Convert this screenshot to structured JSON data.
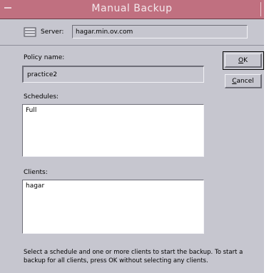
{
  "window": {
    "title": "Manual Backup"
  },
  "server": {
    "label": "Server:",
    "value": "hagar.min.ov.com"
  },
  "policy": {
    "label": "Policy name:",
    "value": "practice2"
  },
  "schedules": {
    "label": "Schedules:",
    "items": [
      "Full"
    ]
  },
  "clients": {
    "label": "Clients:",
    "items": [
      "hagar"
    ]
  },
  "buttons": {
    "ok_label": "OK",
    "ok_underline": "O",
    "ok_rest": "K",
    "cancel_label": "Cancel",
    "cancel_underline": "C",
    "cancel_rest": "ancel"
  },
  "hint": "Select a schedule and one or more clients to start the backup. To start a backup for all clients, press OK without selecting any clients.",
  "icons": {
    "window_menu": "window-menu-icon",
    "server": "server-icon"
  },
  "colors": {
    "titlebar": "#c07080",
    "background": "#c6c6cf",
    "list_background": "#ffffff"
  }
}
